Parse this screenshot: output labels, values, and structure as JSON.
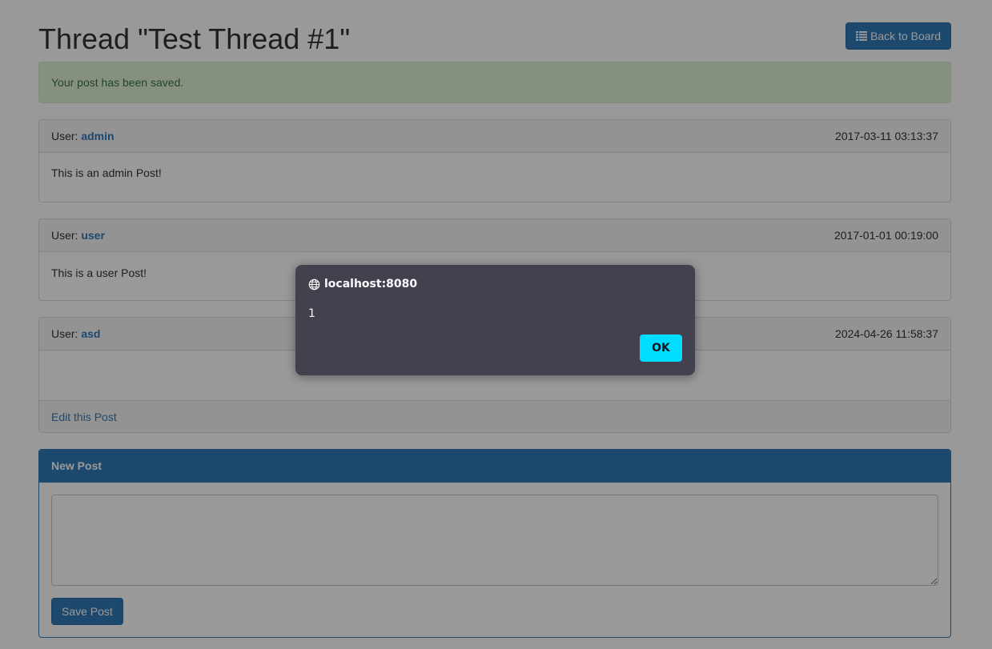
{
  "page": {
    "title": "Thread \"Test Thread #1\"",
    "back_button_label": "Back to Board",
    "back_button_icon": "list-icon"
  },
  "alert": {
    "message": "Your post has been saved."
  },
  "posts": [
    {
      "user_prefix": "User:",
      "username": "admin",
      "timestamp": "2017-03-11 03:13:37",
      "body": "This is an admin Post!"
    },
    {
      "user_prefix": "User:",
      "username": "user",
      "timestamp": "2017-01-01 00:19:00",
      "body": "This is a user Post!"
    },
    {
      "user_prefix": "User:",
      "username": "asd",
      "timestamp": "2024-04-26 11:58:37",
      "body": "",
      "edit_link": "Edit this Post"
    }
  ],
  "new_post": {
    "heading": "New Post",
    "textarea_value": "",
    "save_label": "Save Post"
  },
  "dialog": {
    "origin": "localhost:8080",
    "origin_icon": "globe-icon",
    "message": "1",
    "ok_label": "OK"
  },
  "colors": {
    "primary": "#337ab7",
    "success_bg": "#dff0d8",
    "success_text": "#3c763d",
    "dialog_bg": "#42414d",
    "dialog_button": "#00ddff"
  }
}
